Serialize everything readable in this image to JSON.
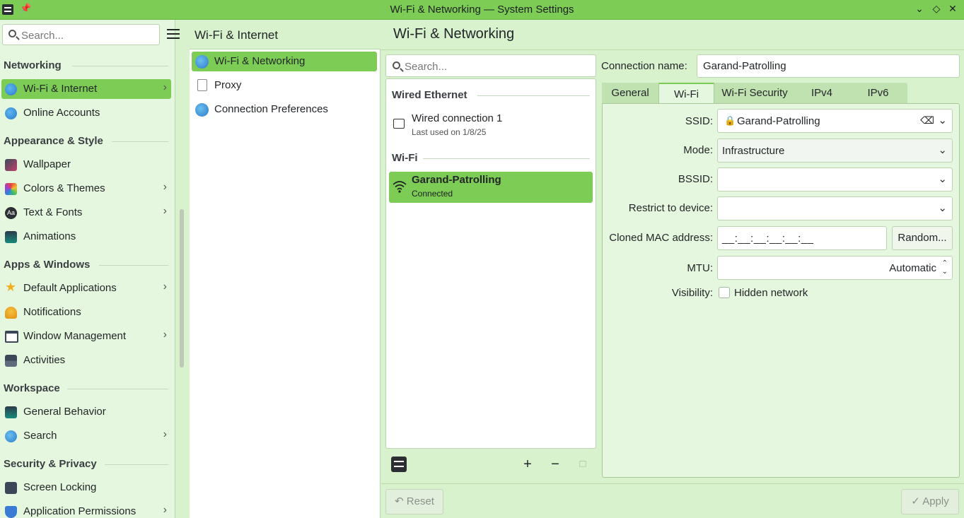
{
  "window": {
    "title": "Wi-Fi & Networking — System Settings",
    "controls": [
      "minimize",
      "maximize",
      "close"
    ]
  },
  "sidebar": {
    "search_placeholder": "Search...",
    "sections": [
      {
        "header": "Networking",
        "items": [
          {
            "label": "Wi-Fi & Internet",
            "icon": "globe-icon",
            "selected": true,
            "has_children": true
          },
          {
            "label": "Online Accounts",
            "icon": "globe-icon",
            "has_children": false
          }
        ]
      },
      {
        "header": "Appearance & Style",
        "items": [
          {
            "label": "Wallpaper",
            "icon": "wallpaper-icon",
            "has_children": false
          },
          {
            "label": "Colors & Themes",
            "icon": "palette-icon",
            "has_children": true
          },
          {
            "label": "Text & Fonts",
            "icon": "font-icon",
            "has_children": true
          },
          {
            "label": "Animations",
            "icon": "animations-icon",
            "has_children": false
          }
        ]
      },
      {
        "header": "Apps & Windows",
        "items": [
          {
            "label": "Default Applications",
            "icon": "star-icon",
            "has_children": true
          },
          {
            "label": "Notifications",
            "icon": "bell-icon",
            "has_children": false
          },
          {
            "label": "Window Management",
            "icon": "window-icon",
            "has_children": true
          },
          {
            "label": "Activities",
            "icon": "activities-icon",
            "has_children": false
          }
        ]
      },
      {
        "header": "Workspace",
        "items": [
          {
            "label": "General Behavior",
            "icon": "behavior-icon",
            "has_children": false
          },
          {
            "label": "Search",
            "icon": "search-icon",
            "has_children": true
          }
        ]
      },
      {
        "header": "Security & Privacy",
        "items": [
          {
            "label": "Screen Locking",
            "icon": "lock-screen-icon",
            "has_children": false
          },
          {
            "label": "Application Permissions",
            "icon": "shield-icon",
            "has_children": true
          }
        ]
      }
    ]
  },
  "middle": {
    "header": "Wi-Fi & Internet",
    "items": [
      {
        "label": "Wi-Fi & Networking",
        "selected": true
      },
      {
        "label": "Proxy"
      },
      {
        "label": "Connection Preferences"
      }
    ]
  },
  "right": {
    "title": "Wi-Fi & Networking",
    "search_placeholder": "Search...",
    "groups": [
      {
        "header": "Wired Ethernet",
        "connections": [
          {
            "name": "Wired connection 1",
            "status": "Last used on 1/8/25",
            "icon": "wired-icon"
          }
        ]
      },
      {
        "header": "Wi-Fi",
        "connections": [
          {
            "name": "Garand-Patrolling",
            "status": "Connected",
            "icon": "wifi-icon",
            "selected": true
          }
        ]
      }
    ],
    "toolbar": {
      "add": "+",
      "remove": "−"
    },
    "form": {
      "connection_name_label": "Connection name:",
      "connection_name_value": "Garand-Patrolling",
      "tabs": [
        "General",
        "Wi-Fi",
        "Wi-Fi Security",
        "IPv4",
        "IPv6"
      ],
      "active_tab": "Wi-Fi",
      "fields": {
        "ssid_label": "SSID:",
        "ssid_value": "Garand-Patrolling",
        "mode_label": "Mode:",
        "mode_value": "Infrastructure",
        "bssid_label": "BSSID:",
        "bssid_value": "",
        "restrict_label": "Restrict to device:",
        "restrict_value": "",
        "mac_label": "Cloned MAC address:",
        "mac_value": "__:__:__:__:__:__",
        "random_label": "Random...",
        "mtu_label": "MTU:",
        "mtu_value": "Automatic",
        "visibility_label": "Visibility:",
        "hidden_network_label": "Hidden network",
        "hidden_network_checked": false
      }
    },
    "buttons": {
      "reset": "Reset",
      "apply": "Apply"
    }
  },
  "colors": {
    "accent": "#7ccc55",
    "background": "#d7f2cd",
    "panel": "#e6f7df"
  }
}
